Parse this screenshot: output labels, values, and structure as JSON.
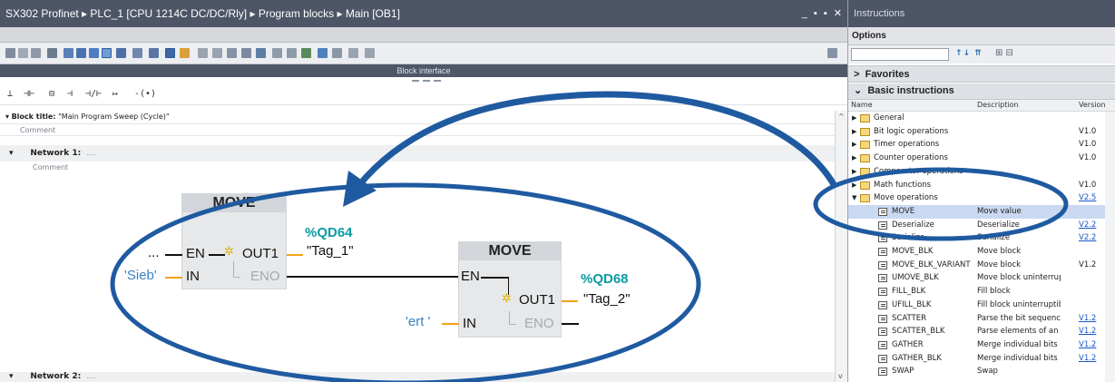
{
  "editor": {
    "breadcrumb": "SX302 Profinet ▸ PLC_1 [CPU 1214C DC/DC/Rly] ▸ Program blocks ▸ Main [OB1]",
    "window_controls": "_ ▪ ▪ ✕",
    "block_interface": "Block interface",
    "block_title_label": "Block title:",
    "block_title_value": "\"Main Program Sweep (Cycle)\"",
    "comment_label": "Comment",
    "network1_label": "Network 1:",
    "network1_dots": "....",
    "network2_label": "Network 2:",
    "network2_dots": "....",
    "favorites": [
      "⊥",
      "⊣⊢",
      "⊟",
      "⊣",
      "⊣/⊢",
      "↦",
      "-(•)"
    ]
  },
  "ladder": {
    "move1": {
      "title": "MOVE",
      "en": "EN",
      "in": "IN",
      "out1": "OUT1",
      "eno": "ENO",
      "input_value": "'Sieb'",
      "output_address": "%QD64",
      "output_tag": "\"Tag_1\"",
      "left_dots": "...",
      "star": "✲"
    },
    "move2": {
      "title": "MOVE",
      "en": "EN",
      "in": "IN",
      "out1": "OUT1",
      "eno": "ENO",
      "input_value": "'ert '",
      "output_address": "%QD68",
      "output_tag": "\"Tag_2\"",
      "star": "✲"
    }
  },
  "instructions": {
    "title": "Instructions",
    "options": "Options",
    "favorites": "Favorites",
    "basic": "Basic instructions",
    "columns": {
      "name": "Name",
      "description": "Description",
      "version": "Version"
    },
    "search_icons": "↑↓ ⇈",
    "rows": [
      {
        "name": "General",
        "desc": "",
        "ver": "",
        "folder": true,
        "tri": "▶"
      },
      {
        "name": "Bit logic operations",
        "desc": "",
        "ver": "V1.0",
        "folder": true,
        "tri": "▶"
      },
      {
        "name": "Timer operations",
        "desc": "",
        "ver": "V1.0",
        "folder": true,
        "tri": "▶"
      },
      {
        "name": "Counter operations",
        "desc": "",
        "ver": "V1.0",
        "folder": true,
        "tri": "▶"
      },
      {
        "name": "Comparator operations",
        "desc": "",
        "ver": "",
        "folder": true,
        "tri": "▶"
      },
      {
        "name": "Math functions",
        "desc": "",
        "ver": "V1.0",
        "folder": true,
        "tri": "▶"
      },
      {
        "name": "Move operations",
        "desc": "",
        "ver": "V2.5",
        "folder": true,
        "tri": "▼",
        "link": true
      },
      {
        "name": "MOVE",
        "desc": "Move value",
        "ver": "",
        "sel": true
      },
      {
        "name": "Deserialize",
        "desc": "Deserialize",
        "ver": "V2.2",
        "link": true
      },
      {
        "name": "Serialize",
        "desc": "Serialize",
        "ver": "V2.2",
        "link": true
      },
      {
        "name": "MOVE_BLK",
        "desc": "Move block",
        "ver": ""
      },
      {
        "name": "MOVE_BLK_VARIANT",
        "desc": "Move block",
        "ver": "V1.2"
      },
      {
        "name": "UMOVE_BLK",
        "desc": "Move block uninterrup...",
        "ver": ""
      },
      {
        "name": "FILL_BLK",
        "desc": "Fill block",
        "ver": ""
      },
      {
        "name": "UFILL_BLK",
        "desc": "Fill block uninterruptible",
        "ver": ""
      },
      {
        "name": "SCATTER",
        "desc": "Parse the bit sequence i...",
        "ver": "V1.2",
        "link": true
      },
      {
        "name": "SCATTER_BLK",
        "desc": "Parse elements of an A...",
        "ver": "V1.2",
        "link": true
      },
      {
        "name": "GATHER",
        "desc": "Merge individual bits in...",
        "ver": "V1.2",
        "link": true
      },
      {
        "name": "GATHER_BLK",
        "desc": "Merge individual bits in...",
        "ver": "V1.2",
        "link": true
      },
      {
        "name": "SWAP",
        "desc": "Swap",
        "ver": ""
      }
    ]
  },
  "colors": {
    "titlebar": "#4d5566",
    "address": "#0a9ba3",
    "input_value": "#3c82c6",
    "annotation": "#1f5aa0",
    "selection": "#c9d9f1"
  }
}
